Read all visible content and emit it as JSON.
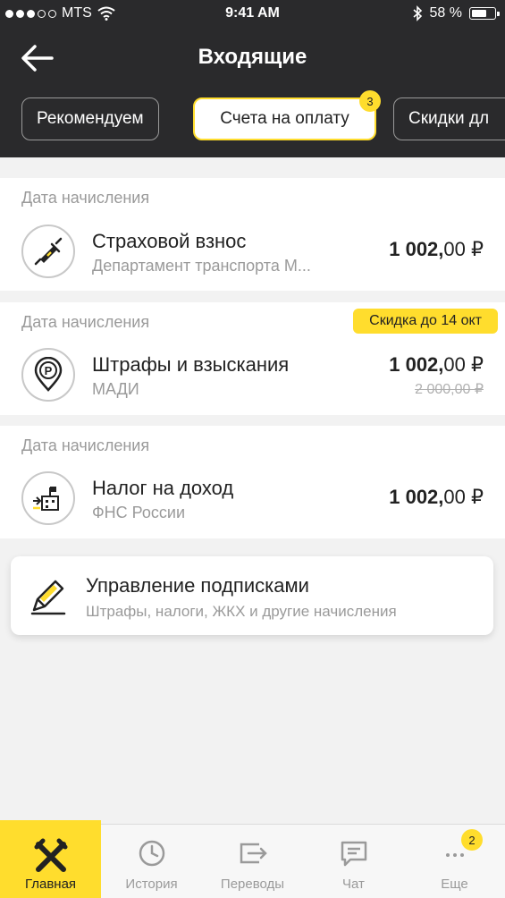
{
  "status_bar": {
    "carrier": "MTS",
    "time": "9:41 AM",
    "battery": "58 %"
  },
  "header": {
    "title": "Входящие"
  },
  "chips": [
    {
      "label": "Рекомендуем",
      "active": false
    },
    {
      "label": "Счета на оплату",
      "active": true,
      "badge": "3"
    },
    {
      "label": "Скидки дл",
      "active": false
    }
  ],
  "bills": [
    {
      "date_label": "Дата начисления",
      "name": "Страховой взнос",
      "payee": "Департамент транспорта М...",
      "amount_int": "1 002,",
      "amount_cents": "00 ₽",
      "icon": "syringe-icon"
    },
    {
      "date_label": "Дата начисления",
      "promo": "Скидка до 14 окт",
      "name": "Штрафы и взыскания",
      "payee": "МАДИ",
      "amount_int": "1 002,",
      "amount_cents": "00 ₽",
      "old_amount": "2 000,00 ₽",
      "icon": "parking-pin-icon"
    },
    {
      "date_label": "Дата начисления",
      "name": "Налог на доход",
      "payee": "ФНС России",
      "amount_int": "1 002,",
      "amount_cents": "00 ₽",
      "icon": "tax-office-icon"
    }
  ],
  "manage": {
    "title": "Управление подписками",
    "subtitle": "Штрафы, налоги, ЖКХ и другие начисления",
    "icon": "pencil-icon"
  },
  "tabbar": [
    {
      "label": "Главная",
      "icon": "raiffeisen-logo-icon",
      "active": true
    },
    {
      "label": "История",
      "icon": "clock-icon",
      "active": false
    },
    {
      "label": "Переводы",
      "icon": "transfer-icon",
      "active": false
    },
    {
      "label": "Чат",
      "icon": "chat-icon",
      "active": false
    },
    {
      "label": "Еще",
      "icon": "more-icon",
      "active": false,
      "badge": "2"
    }
  ],
  "colors": {
    "accent": "#ffdd2d",
    "dark": "#2a2a2c"
  }
}
